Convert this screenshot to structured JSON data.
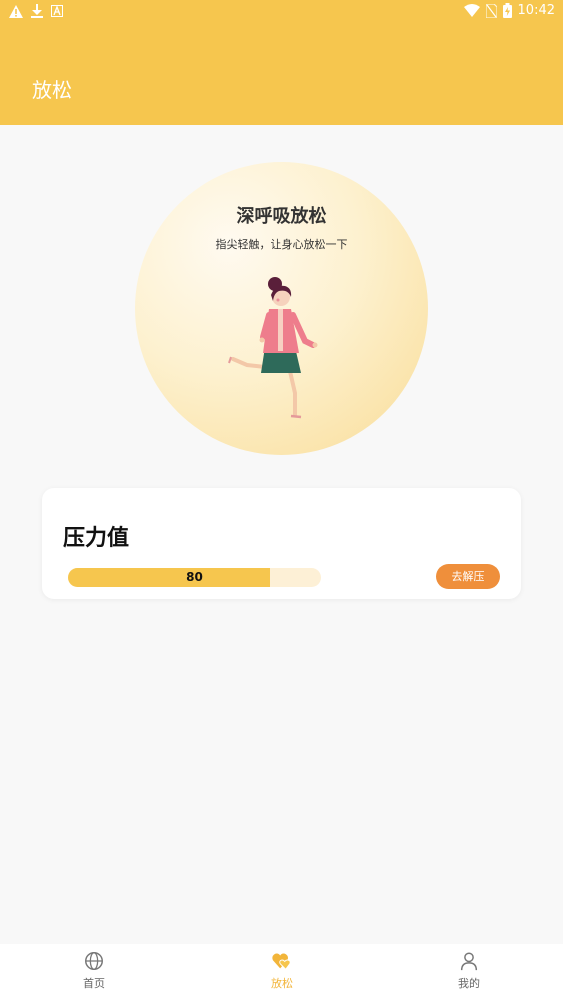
{
  "status_bar": {
    "time": "10:42"
  },
  "header": {
    "title": "放松"
  },
  "hero": {
    "title": "深呼吸放松",
    "subtitle": "指尖轻触，让身心放松一下"
  },
  "stress_card": {
    "title": "压力值",
    "value": "80",
    "progress_percent": 80,
    "button_label": "去解压"
  },
  "bottom_nav": {
    "items": [
      {
        "label": "首页",
        "icon": "globe-icon",
        "active": false
      },
      {
        "label": "放松",
        "icon": "hearts-icon",
        "active": true
      },
      {
        "label": "我的",
        "icon": "person-icon",
        "active": false
      }
    ]
  },
  "colors": {
    "primary": "#f6c64e",
    "accent": "#ef8f3b",
    "track": "#fdf0d6",
    "active_nav": "#f2b53a"
  }
}
